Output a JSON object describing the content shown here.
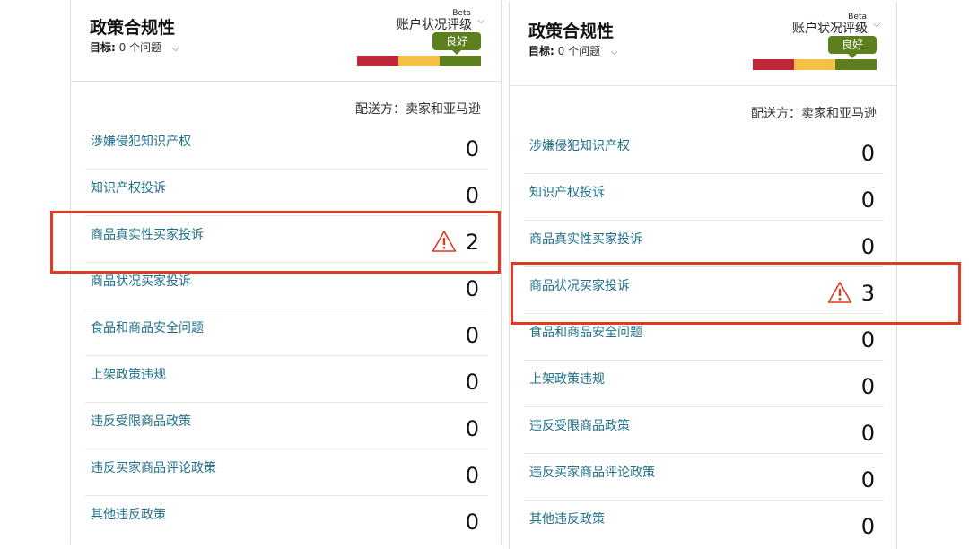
{
  "panels": [
    {
      "title": "政策合规性",
      "target_label": "目标:",
      "target_value": "0 个问题",
      "rating_label": "账户状况评级",
      "beta": "Beta",
      "rating_value": "良好",
      "ship_label": "配送方：卖家和亚马逊",
      "rows": [
        {
          "label": "涉嫌侵犯知识产权",
          "count": "0",
          "warn": false
        },
        {
          "label": "知识产权投诉",
          "count": "0",
          "warn": false
        },
        {
          "label": "商品真实性买家投诉",
          "count": "2",
          "warn": true
        },
        {
          "label": "商品状况买家投诉",
          "count": "0",
          "warn": false
        },
        {
          "label": "食品和商品安全问题",
          "count": "0",
          "warn": false
        },
        {
          "label": "上架政策违规",
          "count": "0",
          "warn": false
        },
        {
          "label": "违反受限商品政策",
          "count": "0",
          "warn": false
        },
        {
          "label": "违反买家商品评论政策",
          "count": "0",
          "warn": false
        },
        {
          "label": "其他违反政策",
          "count": "0",
          "warn": false
        }
      ]
    },
    {
      "title": "政策合规性",
      "target_label": "目标:",
      "target_value": "0 个问题",
      "rating_label": "账户状况评级",
      "beta": "Beta",
      "rating_value": "良好",
      "ship_label": "配送方：卖家和亚马逊",
      "rows": [
        {
          "label": "涉嫌侵犯知识产权",
          "count": "0",
          "warn": false
        },
        {
          "label": "知识产权投诉",
          "count": "0",
          "warn": false
        },
        {
          "label": "商品真实性买家投诉",
          "count": "0",
          "warn": false
        },
        {
          "label": "商品状况买家投诉",
          "count": "3",
          "warn": true
        },
        {
          "label": "食品和商品安全问题",
          "count": "0",
          "warn": false
        },
        {
          "label": "上架政策违规",
          "count": "0",
          "warn": false
        },
        {
          "label": "违反受限商品政策",
          "count": "0",
          "warn": false
        },
        {
          "label": "违反买家商品评论政策",
          "count": "0",
          "warn": false
        },
        {
          "label": "其他违反政策",
          "count": "0",
          "warn": false
        }
      ]
    }
  ],
  "colors": {
    "link": "#1f6f8b",
    "highlight": "#e03a24",
    "rating_good": "#5e7f1e",
    "bar": [
      "#c0263a",
      "#f2c144",
      "#5e7f1e"
    ]
  },
  "icons": {
    "warning": "warning-triangle-icon",
    "dropdown": "chevron-down-icon"
  }
}
